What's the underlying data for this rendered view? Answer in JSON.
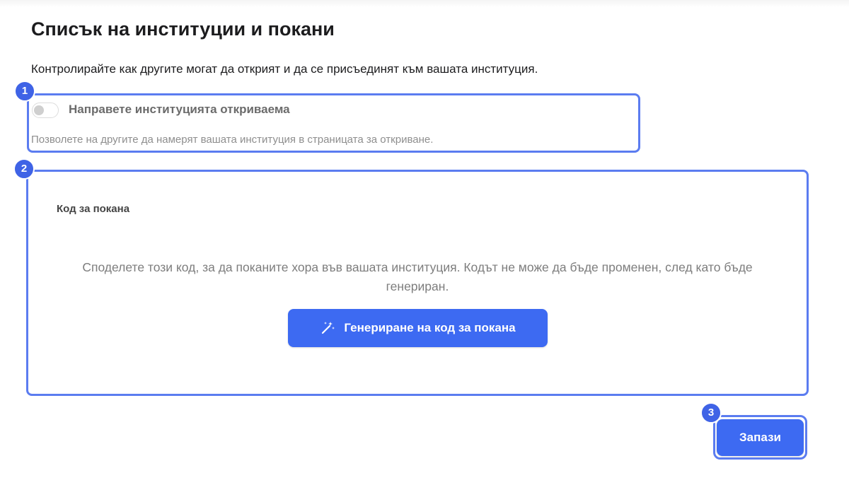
{
  "header": {
    "title": "Списък на институции и покани",
    "subtitle": "Контролирайте как другите могат да открият и да се присъединят към вашата институция."
  },
  "discoverable": {
    "label": "Направете институцията откриваема",
    "help": "Позволете на другите да намерят вашата институция в страницата за откриване.",
    "enabled": false
  },
  "invite": {
    "section_title": "Код за покана",
    "description": "Споделете този код, за да поканите хора във вашата институция. Кодът не може да бъде променен, след като бъде генериран.",
    "generate_label": "Генериране на код за покана",
    "generate_icon": "magic-wand-icon"
  },
  "footer": {
    "save_label": "Запази"
  },
  "annotations": {
    "badges": [
      "1",
      "2",
      "3"
    ]
  },
  "colors": {
    "accent": "#3d6af2",
    "callout": "#5b7cf0",
    "badge": "#3f63e6"
  }
}
